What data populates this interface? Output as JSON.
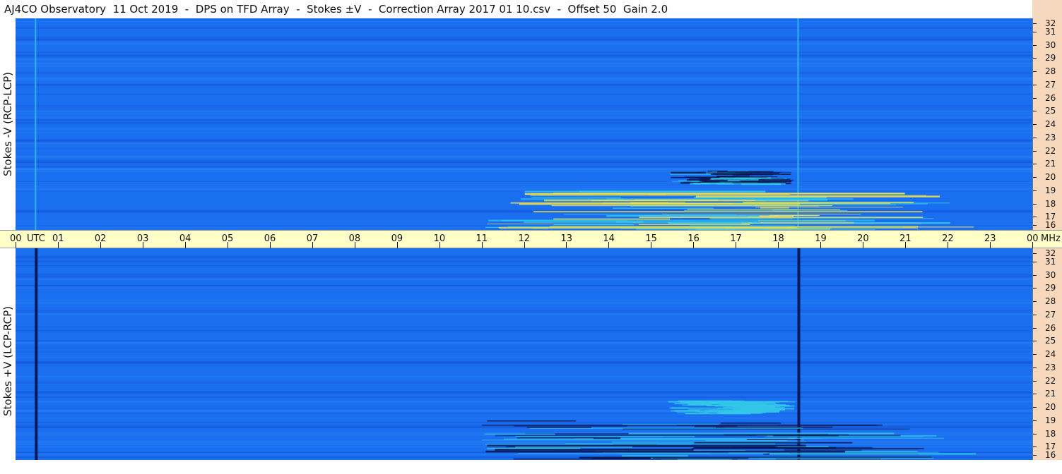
{
  "title": "AJ4CO Observatory  11 Oct 2019  -  DPS on TFD Array  -  Stokes ±V  -  Correction Array 2017 01 10.csv  -  Offset 50  Gain 2.0",
  "colors": {
    "background_blue": "#1a6ff0",
    "deep_blue": "#1452d6",
    "cyan": "#33c7e8",
    "yellow": "#f2e24a",
    "dark_line": "#0a1450",
    "time_strip": "#ffffc8",
    "freq_axis": "#f7d8bc"
  },
  "chart_data": [
    {
      "type": "heatmap",
      "panel": "top",
      "ylabel": "Stokes -V  (RCP-LCP)",
      "ylim": [
        16,
        32
      ],
      "yticks": [
        "32",
        "31",
        "30",
        "29",
        "28",
        "27",
        "26",
        "25",
        "24",
        "23",
        "22",
        "21",
        "20",
        "19",
        "18",
        "17",
        "16"
      ],
      "xlim": [
        0,
        24
      ],
      "features": [
        {
          "kind": "vertical-line",
          "time_h": 0.48,
          "color": "cyan"
        },
        {
          "kind": "vertical-line",
          "time_h": 18.48,
          "color": "cyan"
        },
        {
          "kind": "emission-band",
          "time_start_h": 11.0,
          "time_end_h": 23.5,
          "freq_low_mhz": 16.0,
          "freq_high_mhz": 19.0,
          "color": "yellow"
        },
        {
          "kind": "emission-band",
          "time_start_h": 15.4,
          "time_end_h": 18.4,
          "freq_low_mhz": 19.5,
          "freq_high_mhz": 20.5,
          "color": "dark"
        }
      ]
    },
    {
      "type": "heatmap",
      "panel": "bottom",
      "ylabel": "Stokes +V  (LCP-RCP)",
      "ylim": [
        16,
        32
      ],
      "yticks": [
        "32",
        "31",
        "30",
        "29",
        "28",
        "27",
        "26",
        "25",
        "24",
        "23",
        "22",
        "21",
        "20",
        "19",
        "18",
        "17",
        "16"
      ],
      "xlim": [
        0,
        24
      ],
      "features": [
        {
          "kind": "vertical-line",
          "time_h": 0.48,
          "color": "dark"
        },
        {
          "kind": "vertical-line",
          "time_h": 18.48,
          "color": "dark"
        },
        {
          "kind": "emission-band",
          "time_start_h": 11.0,
          "time_end_h": 23.5,
          "freq_low_mhz": 16.0,
          "freq_high_mhz": 19.0,
          "color": "dark"
        },
        {
          "kind": "emission-band",
          "time_start_h": 15.4,
          "time_end_h": 18.4,
          "freq_low_mhz": 19.5,
          "freq_high_mhz": 20.5,
          "color": "cyan"
        }
      ]
    }
  ],
  "time_axis": {
    "labels": [
      "00",
      "UTC",
      "01",
      "02",
      "03",
      "04",
      "05",
      "06",
      "07",
      "08",
      "09",
      "10",
      "11",
      "12",
      "13",
      "14",
      "15",
      "16",
      "17",
      "18",
      "19",
      "20",
      "21",
      "22",
      "23",
      "00",
      "MHz"
    ]
  }
}
